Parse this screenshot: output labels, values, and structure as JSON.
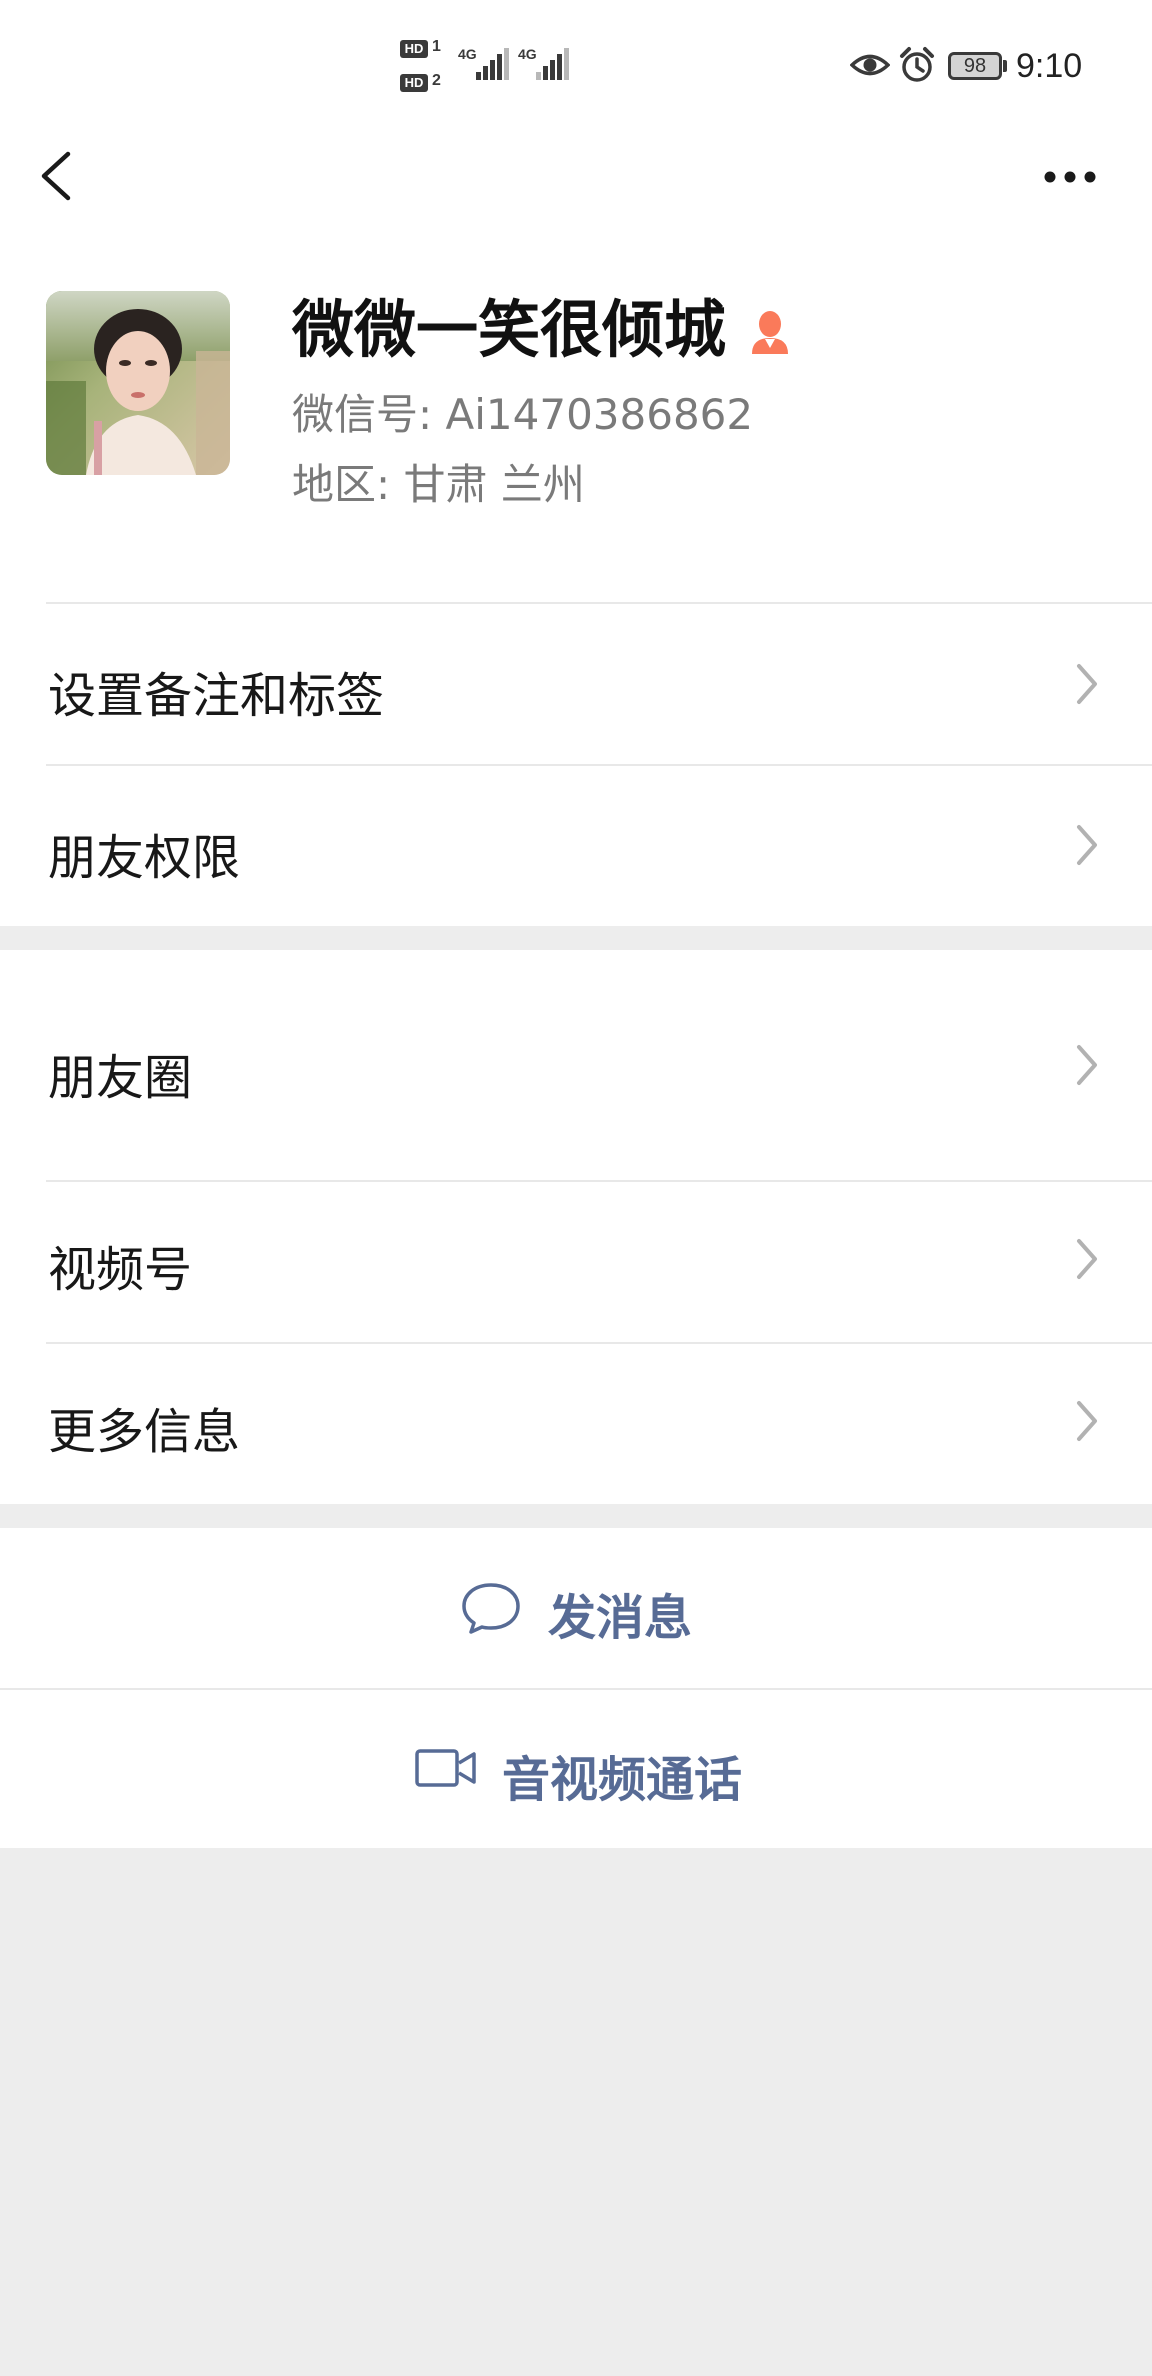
{
  "status_bar": {
    "sim1_label": "HD",
    "sim1_num": "1",
    "sim2_label": "HD",
    "sim2_num": "2",
    "network1": "4G",
    "network2": "4G",
    "battery": "98",
    "time": "9:10"
  },
  "profile": {
    "name": "微微一笑很倾城",
    "wechat_id": "微信号:  Ai1470386862",
    "region": "地区:  甘肃  兰州",
    "gender_icon": "female-icon",
    "gender_color": "#fa7a5a"
  },
  "rows": {
    "remark_tags": "设置备注和标签",
    "friend_permissions": "朋友权限",
    "moments": "朋友圈",
    "channels": "视频号",
    "more_info": "更多信息"
  },
  "actions": {
    "send_message": "发消息",
    "video_call": "音视频通话",
    "link_color": "#576b95"
  }
}
